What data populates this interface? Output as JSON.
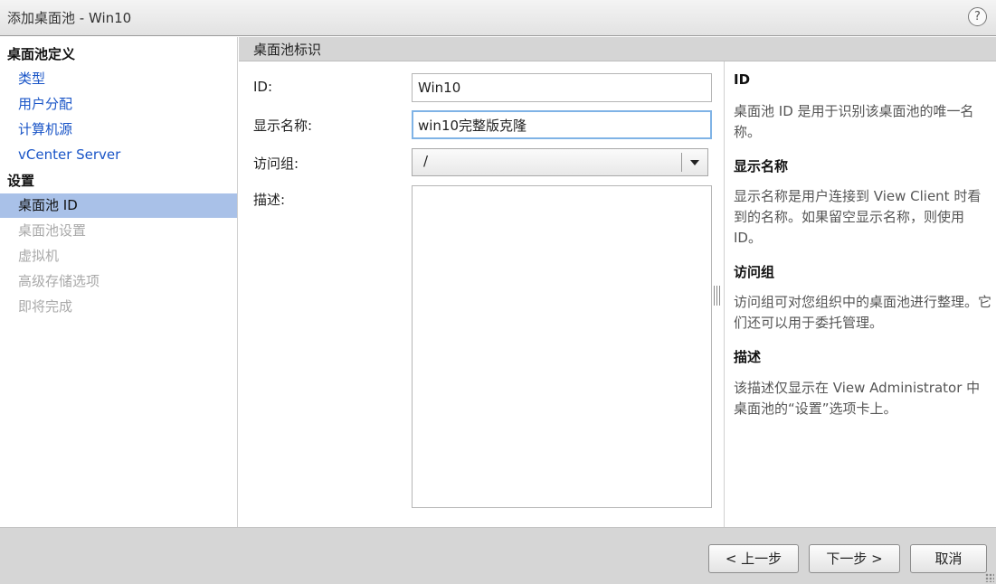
{
  "window": {
    "title": "添加桌面池 - Win10",
    "help_glyph": "?"
  },
  "sidebar": {
    "sections": [
      {
        "label": "桌面池定义"
      },
      {
        "label": "设置"
      }
    ],
    "items": [
      {
        "label": "类型",
        "state": "link"
      },
      {
        "label": "用户分配",
        "state": "link"
      },
      {
        "label": "计算机源",
        "state": "link"
      },
      {
        "label": "vCenter Server",
        "state": "link"
      },
      {
        "label": "桌面池 ID",
        "state": "active"
      },
      {
        "label": "桌面池设置",
        "state": "disabled"
      },
      {
        "label": "虚拟机",
        "state": "disabled"
      },
      {
        "label": "高级存储选项",
        "state": "disabled"
      },
      {
        "label": "即将完成",
        "state": "disabled"
      }
    ]
  },
  "main": {
    "header": "桌面池标识",
    "fields": {
      "id_label": "ID:",
      "id_value": "Win10",
      "display_name_label": "显示名称:",
      "display_name_value": "win10完整版克隆",
      "access_group_label": "访问组:",
      "access_group_value": "/",
      "description_label": "描述:",
      "description_value": ""
    }
  },
  "help": {
    "sections": [
      {
        "heading": "ID",
        "text": "桌面池 ID 是用于识别该桌面池的唯一名称。"
      },
      {
        "heading": "显示名称",
        "text": "显示名称是用户连接到 View Client 时看到的名称。如果留空显示名称，则使用 ID。"
      },
      {
        "heading": "访问组",
        "text": "访问组可对您组织中的桌面池进行整理。它们还可以用于委托管理。"
      },
      {
        "heading": "描述",
        "text": "该描述仅显示在 View Administrator 中桌面池的“设置”选项卡上。"
      }
    ]
  },
  "footer": {
    "back_label": "< 上一步",
    "next_label": "下一步 >",
    "cancel_label": "取消"
  },
  "colors": {
    "link": "#1a55c7",
    "active_bg": "#a9c1e8",
    "disabled": "#a9a9a9",
    "focus_border": "#7fb3e6"
  }
}
